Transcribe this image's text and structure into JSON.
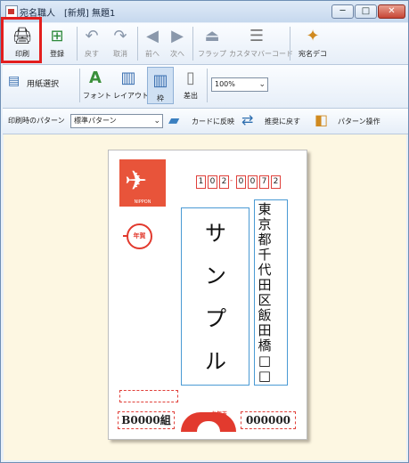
{
  "window": {
    "title": "宛名職人　[新規]  無題1",
    "minimize": "─",
    "maximize": "□",
    "close": "✕"
  },
  "toolbar_main": {
    "print": "印刷",
    "register": "登録",
    "undo": "戻す",
    "cancel": "取消",
    "prev": "前へ",
    "next": "次へ",
    "flap": "フラップ",
    "custom_barcode": "カスタマバーコード",
    "address_deco": "宛名デコ"
  },
  "toolbar_layout": {
    "paper_select": "用紙選択",
    "font": "フォント",
    "layout": "レイアウト",
    "frame": "枠",
    "sender": "差出",
    "zoom": "100%"
  },
  "toolbar_pattern": {
    "pattern_label": "印刷時のパターン",
    "pattern_value": "標準パターン",
    "apply_card": "カードに反映",
    "restore_recommended": "推奨に戻す",
    "pattern_ops": "パターン操作"
  },
  "postcard": {
    "zip_digits": [
      "1",
      "0",
      "2",
      "0",
      "0",
      "7",
      "2"
    ],
    "zip_dash": "-",
    "stamp_text": "NIPPON",
    "nenga": "年賀",
    "recipient_name": [
      "サ",
      "ン",
      "プ",
      "ル"
    ],
    "address_chars": [
      "東",
      "京",
      "都",
      "千",
      "代",
      "田",
      "区",
      "飯",
      "田",
      "橋",
      "□",
      "□"
    ],
    "lot_left": "B0000組",
    "lot_right": "000000",
    "otoshidama": "お年玉"
  },
  "colors": {
    "accent_red": "#e23a2e",
    "frame_blue": "#4a9ad4",
    "workspace": "#fdf7e2"
  }
}
